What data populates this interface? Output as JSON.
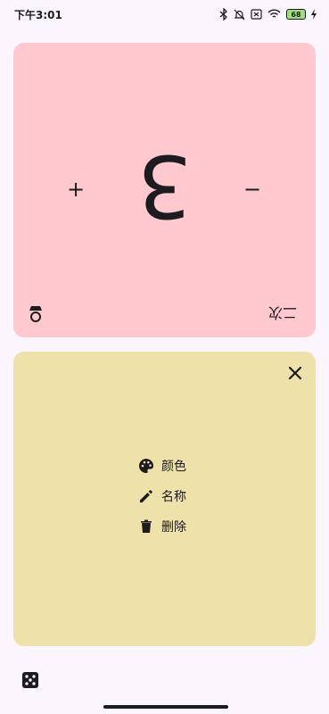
{
  "status_bar": {
    "time": "下午3:01",
    "battery": "68"
  },
  "counter_card": {
    "value": "3",
    "plus": "+",
    "minus": "−",
    "bottom_right_label": "二次"
  },
  "menu_card": {
    "items": [
      {
        "label": "颜色",
        "icon": "palette-icon"
      },
      {
        "label": "名称",
        "icon": "pencil-icon"
      },
      {
        "label": "删除",
        "icon": "trash-icon"
      }
    ]
  },
  "colors": {
    "background": "#fbf5fd",
    "counter_card": "#ffc9cf",
    "menu_card": "#eee1aa",
    "text": "#1c1b1f"
  }
}
